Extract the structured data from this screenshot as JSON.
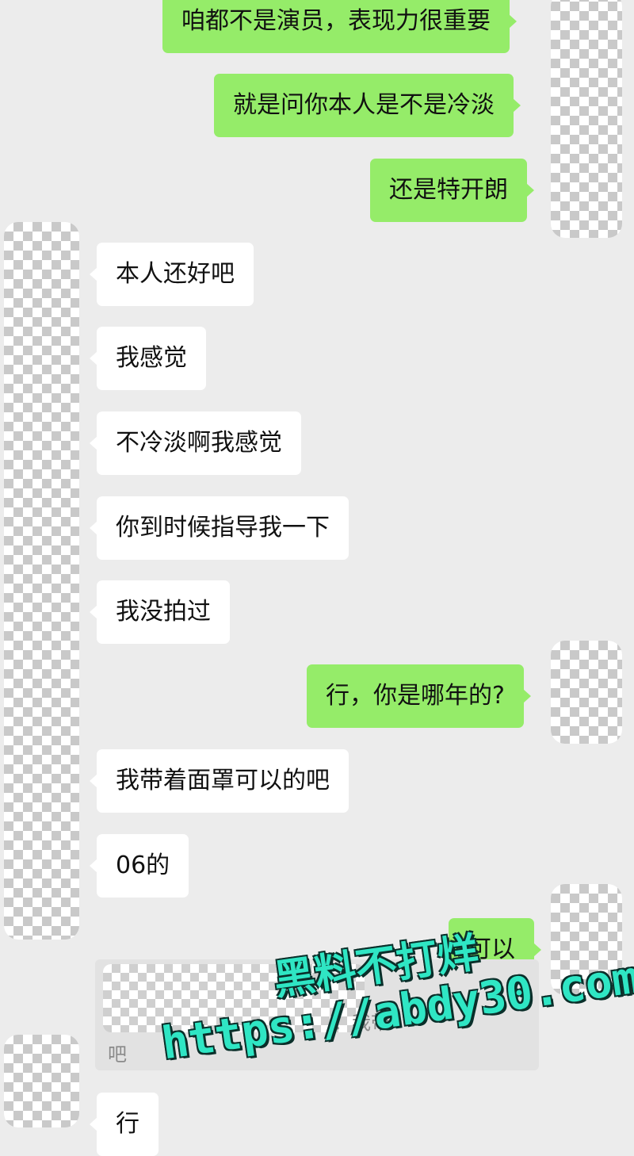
{
  "messages": [
    {
      "side": "out",
      "text": "咱都不是演员，表现力很重要"
    },
    {
      "side": "out",
      "text": "就是问你本人是不是冷淡"
    },
    {
      "side": "out",
      "text": "还是特开朗"
    },
    {
      "side": "in",
      "text": "本人还好吧"
    },
    {
      "side": "in",
      "text": "我感觉"
    },
    {
      "side": "in",
      "text": "不冷淡啊我感觉"
    },
    {
      "side": "in",
      "text": "你到时候指导我一下"
    },
    {
      "side": "in",
      "text": "我没拍过"
    },
    {
      "side": "out",
      "text": "行，你是哪年的?"
    },
    {
      "side": "in",
      "text": "我带着面罩可以的吧"
    },
    {
      "side": "in",
      "text": "06的"
    },
    {
      "side": "out",
      "text": "可以"
    },
    {
      "side": "in",
      "text": "行"
    }
  ],
  "quote": {
    "visible_fragment": "：我带",
    "tail": "吧"
  },
  "watermark": {
    "line1": "黑料不打烊",
    "line2": "https://abdy30.com"
  },
  "colors": {
    "background": "#ececec",
    "outgoing_bubble": "#95ec69",
    "incoming_bubble": "#ffffff",
    "watermark": "#2fe6c4"
  }
}
